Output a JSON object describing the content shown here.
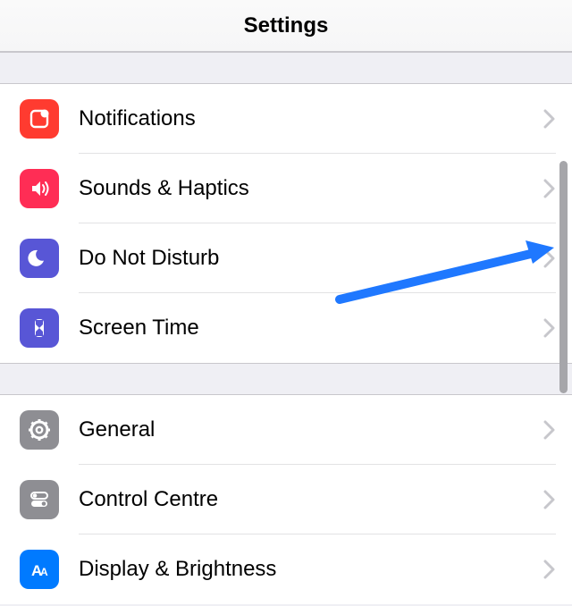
{
  "header": {
    "title": "Settings"
  },
  "groups": [
    {
      "rows": [
        {
          "id": "notifications",
          "label": "Notifications",
          "icon": "notifications-icon",
          "bg": "#ff3b30"
        },
        {
          "id": "sounds",
          "label": "Sounds & Haptics",
          "icon": "speaker-icon",
          "bg": "#ff2d55"
        },
        {
          "id": "dnd",
          "label": "Do Not Disturb",
          "icon": "moon-icon",
          "bg": "#5856d6"
        },
        {
          "id": "screentime",
          "label": "Screen Time",
          "icon": "hourglass-icon",
          "bg": "#5856d6"
        }
      ]
    },
    {
      "rows": [
        {
          "id": "general",
          "label": "General",
          "icon": "gear-icon",
          "bg": "#8e8e93"
        },
        {
          "id": "controlcentre",
          "label": "Control Centre",
          "icon": "switches-icon",
          "bg": "#8e8e93"
        },
        {
          "id": "display",
          "label": "Display & Brightness",
          "icon": "text-size-icon",
          "bg": "#007aff"
        }
      ]
    }
  ]
}
